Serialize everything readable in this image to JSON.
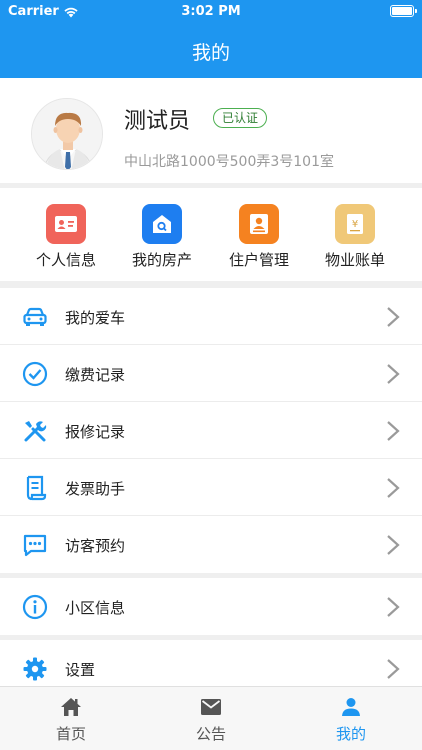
{
  "status_bar": {
    "carrier": "Carrier",
    "time": "3:02 PM"
  },
  "header": {
    "title": "我的"
  },
  "profile": {
    "name": "测试员",
    "badge": "已认证",
    "address": "中山北路1000号500弄3号101室"
  },
  "shortcuts": [
    {
      "label": "个人信息",
      "icon": "id-card-icon",
      "color": "#f0645a"
    },
    {
      "label": "我的房产",
      "icon": "house-search-icon",
      "color": "#1e7ef0"
    },
    {
      "label": "住户管理",
      "icon": "resident-icon",
      "color": "#f58220"
    },
    {
      "label": "物业账单",
      "icon": "bill-icon",
      "color": "#f0c878"
    }
  ],
  "menu": {
    "group1": [
      {
        "label": "我的爱车",
        "icon": "car-icon"
      },
      {
        "label": "缴费记录",
        "icon": "check-circle-icon"
      },
      {
        "label": "报修记录",
        "icon": "tools-icon"
      },
      {
        "label": "发票助手",
        "icon": "receipt-icon"
      },
      {
        "label": "访客预约",
        "icon": "message-icon"
      }
    ],
    "group2": [
      {
        "label": "小区信息",
        "icon": "info-icon"
      }
    ],
    "group3": [
      {
        "label": "设置",
        "icon": "gear-icon"
      }
    ]
  },
  "tabbar": [
    {
      "label": "首页",
      "icon": "home-icon",
      "active": false
    },
    {
      "label": "公告",
      "icon": "mail-icon",
      "active": false
    },
    {
      "label": "我的",
      "icon": "person-icon",
      "active": true
    }
  ],
  "colors": {
    "primary": "#1e96f0",
    "badge_green": "#4caf50",
    "background": "#efefef"
  }
}
